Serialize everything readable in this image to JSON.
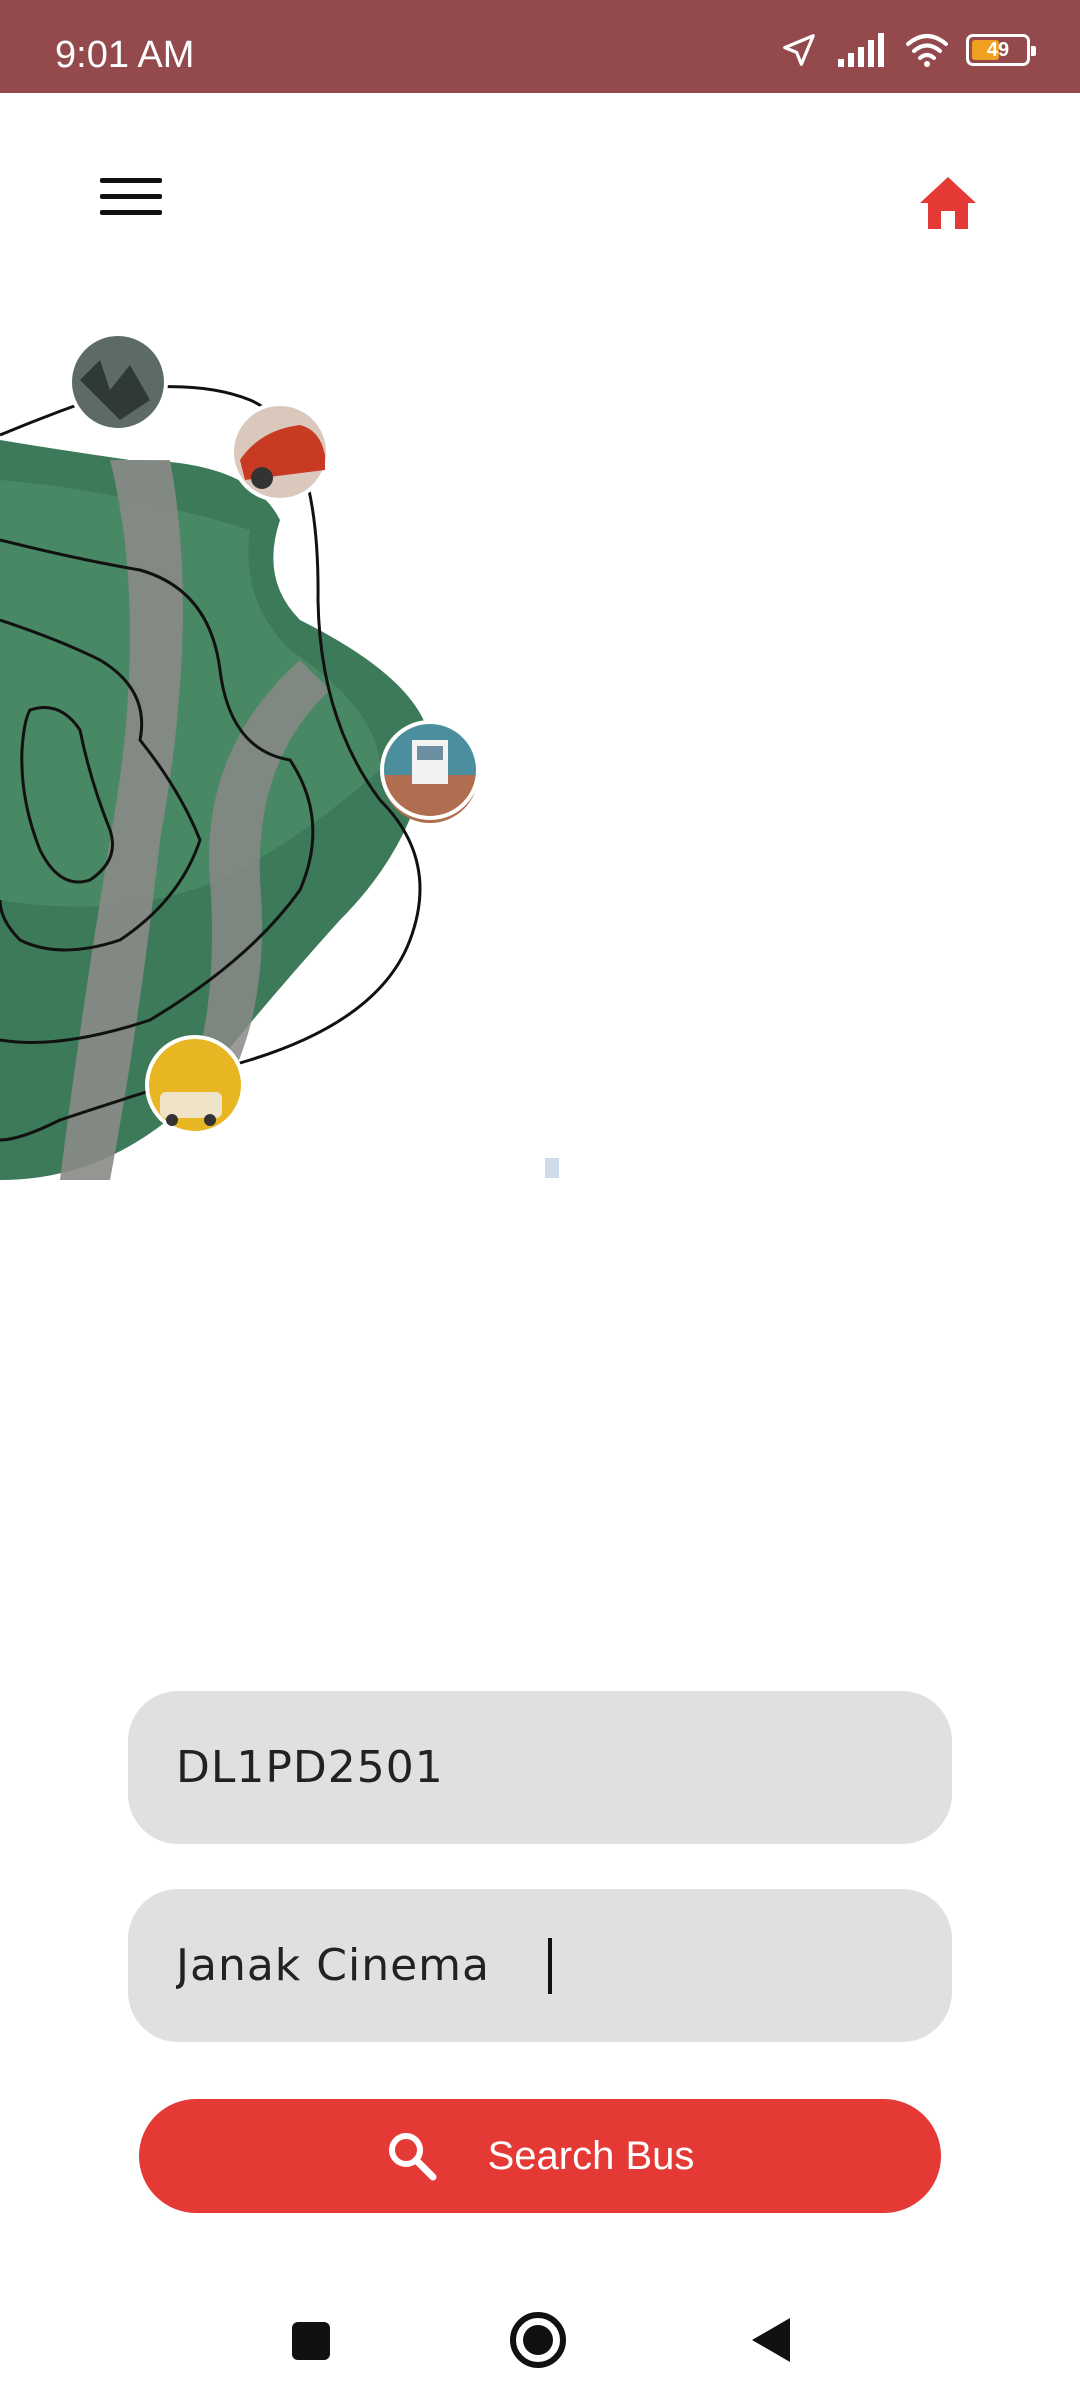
{
  "status_bar": {
    "time": "9:01 AM",
    "battery_level": "49",
    "icons": [
      "location-arrow-icon",
      "signal-icon",
      "wifi-icon",
      "battery-icon"
    ]
  },
  "header": {
    "menu_icon": "hamburger-menu-icon",
    "home_icon": "home-icon",
    "accent_color": "#e53935"
  },
  "form": {
    "vehicle_number_value": "DL1PD2501",
    "stop_value": "Janak Cinema"
  },
  "search_button": {
    "label": "Search Bus",
    "icon": "search-icon",
    "color": "#e53935"
  },
  "nav_bar": {
    "items": [
      "recents-square-icon",
      "home-circle-icon",
      "back-triangle-icon"
    ]
  }
}
